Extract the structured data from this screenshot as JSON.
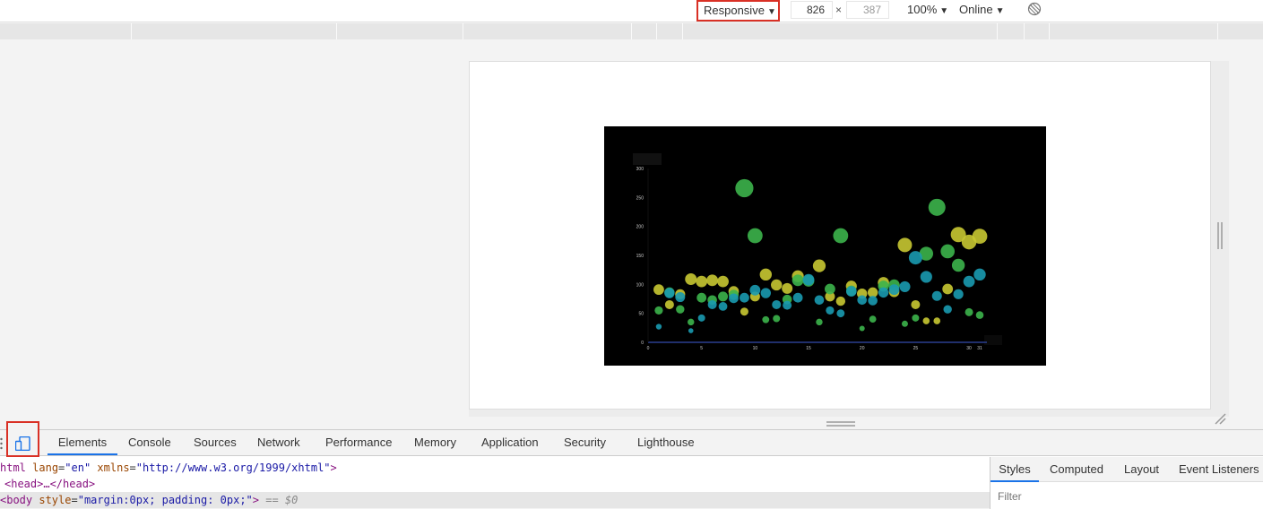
{
  "toolbar": {
    "device_label": "Responsive",
    "width_value": "826",
    "height_value": "387",
    "dim_separator": "×",
    "zoom_label": "100%",
    "throttle_label": "Online",
    "caret": "▼"
  },
  "devtools": {
    "tabs": [
      "Elements",
      "Console",
      "Sources",
      "Network",
      "Performance",
      "Memory",
      "Application",
      "Security",
      "Lighthouse"
    ],
    "active_tab": "Elements",
    "dom": {
      "line1_tag": "html",
      "line1_attr1": "lang",
      "line1_val1": "\"en\"",
      "line1_attr2": "xmlns",
      "line1_val2": "\"http://www.w3.org/1999/xhtml\"",
      "line2": "<head>…</head>",
      "line3_tag": "<body",
      "line3_attr": "style",
      "line3_val": "\"margin:0px; padding: 0px;\"",
      "line3_end": ">",
      "line3_eq": "== $0"
    },
    "styles_tabs": [
      "Styles",
      "Computed",
      "Layout",
      "Event Listeners"
    ],
    "filter_placeholder": "Filter"
  },
  "chart_data": {
    "type": "scatter",
    "title": "",
    "xlabel": "",
    "ylabel": "",
    "xlim": [
      0,
      31
    ],
    "ylim": [
      0,
      300
    ],
    "xticks": [
      0,
      5,
      10,
      15,
      20,
      25,
      30,
      31
    ],
    "yticks": [
      0,
      50,
      100,
      150,
      200,
      250,
      300
    ],
    "grid": false,
    "background": "#000000",
    "series": [
      {
        "color": "#c8c832",
        "points": [
          [
            1,
            91
          ],
          [
            2,
            65
          ],
          [
            3,
            83
          ],
          [
            4,
            109
          ],
          [
            5,
            105
          ],
          [
            6,
            107
          ],
          [
            7,
            105
          ],
          [
            8,
            88
          ],
          [
            9,
            53
          ],
          [
            10,
            79
          ],
          [
            11,
            117
          ],
          [
            12,
            99
          ],
          [
            13,
            93
          ],
          [
            14,
            114
          ],
          [
            16,
            132
          ],
          [
            17,
            79
          ],
          [
            18,
            71
          ],
          [
            19,
            97
          ],
          [
            20,
            84
          ],
          [
            21,
            86
          ],
          [
            22,
            103
          ],
          [
            23,
            87
          ],
          [
            24,
            168
          ],
          [
            25,
            65
          ],
          [
            26,
            37
          ],
          [
            27,
            37
          ],
          [
            28,
            92
          ],
          [
            29,
            186
          ],
          [
            30,
            173
          ],
          [
            31,
            183
          ]
        ]
      },
      {
        "color": "#3cb44b",
        "points": [
          [
            1,
            55
          ],
          [
            2,
            86
          ],
          [
            3,
            57
          ],
          [
            4,
            35
          ],
          [
            5,
            77
          ],
          [
            6,
            73
          ],
          [
            7,
            79
          ],
          [
            8,
            82
          ],
          [
            9,
            266
          ],
          [
            10,
            184
          ],
          [
            11,
            39
          ],
          [
            12,
            41
          ],
          [
            13,
            74
          ],
          [
            14,
            107
          ],
          [
            15,
            106
          ],
          [
            16,
            35
          ],
          [
            17,
            92
          ],
          [
            18,
            184
          ],
          [
            19,
            89
          ],
          [
            20,
            24
          ],
          [
            21,
            40
          ],
          [
            22,
            97
          ],
          [
            23,
            99
          ],
          [
            24,
            32
          ],
          [
            25,
            42
          ],
          [
            26,
            153
          ],
          [
            27,
            233
          ],
          [
            28,
            157
          ],
          [
            29,
            133
          ],
          [
            30,
            52
          ],
          [
            31,
            47
          ]
        ]
      },
      {
        "color": "#1a9ab0",
        "points": [
          [
            1,
            27
          ],
          [
            2,
            85
          ],
          [
            3,
            78
          ],
          [
            4,
            20
          ],
          [
            5,
            42
          ],
          [
            6,
            65
          ],
          [
            7,
            62
          ],
          [
            8,
            76
          ],
          [
            9,
            77
          ],
          [
            10,
            90
          ],
          [
            11,
            85
          ],
          [
            12,
            65
          ],
          [
            13,
            64
          ],
          [
            14,
            77
          ],
          [
            15,
            108
          ],
          [
            16,
            73
          ],
          [
            17,
            55
          ],
          [
            18,
            50
          ],
          [
            19,
            88
          ],
          [
            20,
            73
          ],
          [
            21,
            72
          ],
          [
            22,
            86
          ],
          [
            23,
            91
          ],
          [
            24,
            96
          ],
          [
            25,
            146
          ],
          [
            26,
            113
          ],
          [
            27,
            80
          ],
          [
            28,
            57
          ],
          [
            29,
            83
          ],
          [
            30,
            105
          ],
          [
            31,
            117
          ]
        ]
      }
    ]
  }
}
